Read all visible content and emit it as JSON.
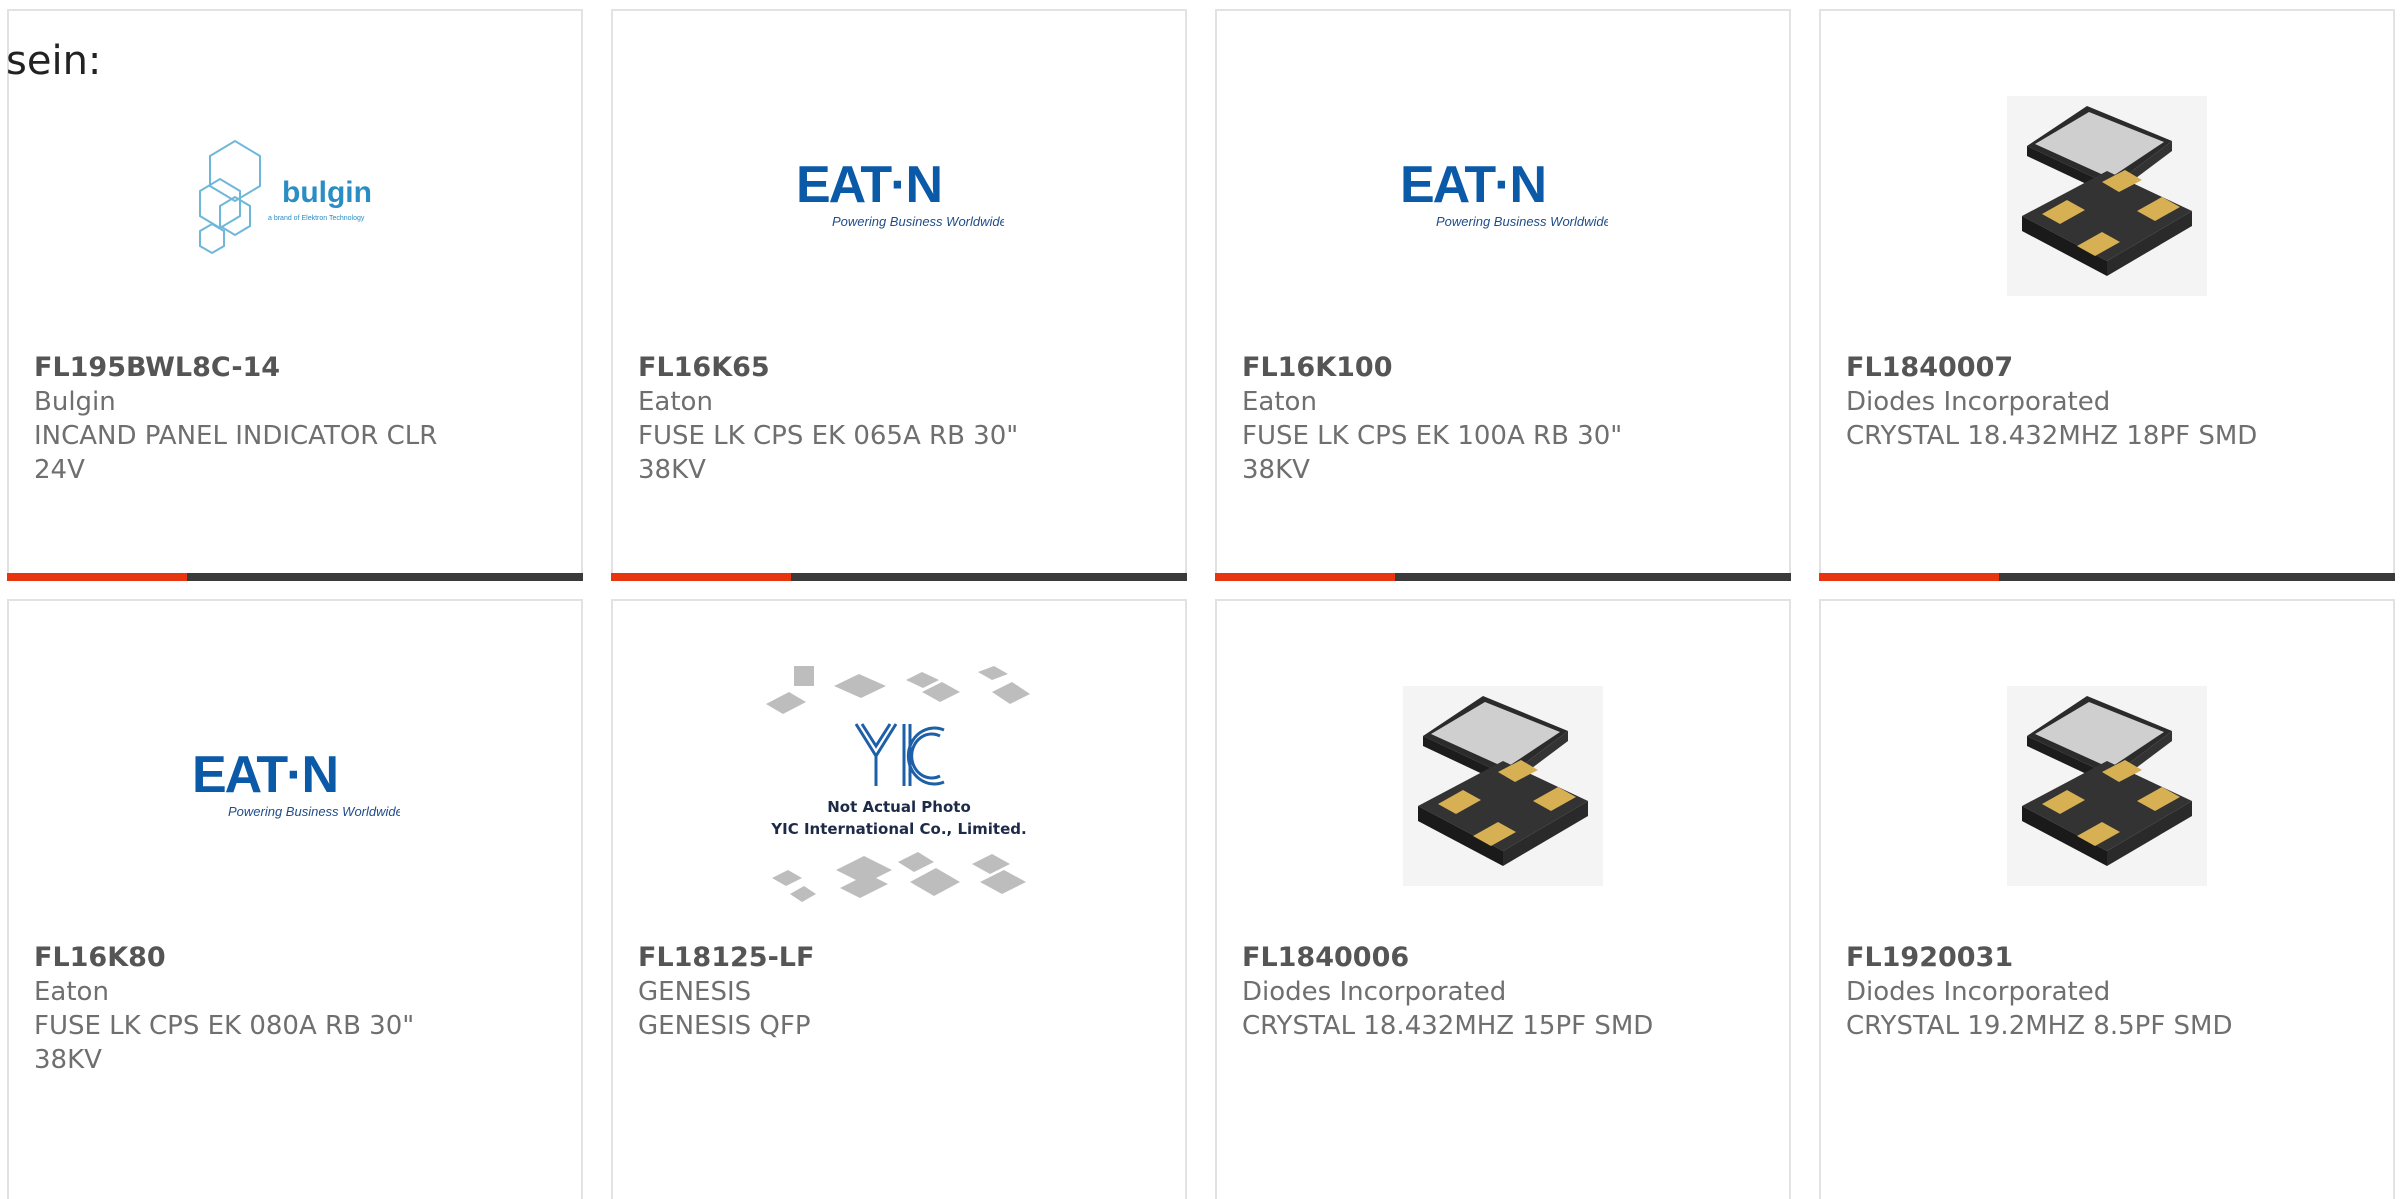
{
  "page": {
    "label": "sein:",
    "accent_color": "#e7350f",
    "bar_color": "#3a3a3a"
  },
  "products": [
    {
      "part_number": "FL195BWL8C-14",
      "manufacturer": "Bulgin",
      "description": "INCAND PANEL INDICATOR CLR 24V",
      "image": "bulgin-logo",
      "logo_text": "bulgin",
      "logo_sub": "a brand of Elektron Technology"
    },
    {
      "part_number": "FL16K65",
      "manufacturer": "Eaton",
      "description": "FUSE LK CPS EK 065A RB 30\" 38KV",
      "image": "eaton-logo",
      "logo_text": "EAT·N",
      "logo_sub": "Powering Business Worldwide"
    },
    {
      "part_number": "FL16K100",
      "manufacturer": "Eaton",
      "description": "FUSE LK CPS EK 100A RB 30\" 38KV",
      "image": "eaton-logo",
      "logo_text": "EAT·N",
      "logo_sub": "Powering Business Worldwide"
    },
    {
      "part_number": "FL1840007",
      "manufacturer": "Diodes Incorporated",
      "description": "CRYSTAL 18.432MHZ 18PF SMD",
      "image": "crystal-photo"
    },
    {
      "part_number": "FL16K80",
      "manufacturer": "Eaton",
      "description": "FUSE LK CPS EK 080A RB 30\" 38KV",
      "image": "eaton-logo",
      "logo_text": "EAT·N",
      "logo_sub": "Powering Business Worldwide"
    },
    {
      "part_number": "FL18125-LF",
      "manufacturer": "GENESIS",
      "description": "GENESIS QFP",
      "image": "yic-placeholder",
      "logo_text": "YIC",
      "placeholder_line1": "Not Actual Photo",
      "placeholder_line2": "YIC International Co., Limited."
    },
    {
      "part_number": "FL1840006",
      "manufacturer": "Diodes Incorporated",
      "description": "CRYSTAL 18.432MHZ 15PF SMD",
      "image": "crystal-photo"
    },
    {
      "part_number": "FL1920031",
      "manufacturer": "Diodes Incorporated",
      "description": "CRYSTAL 19.2MHZ 8.5PF SMD",
      "image": "crystal-photo"
    }
  ]
}
